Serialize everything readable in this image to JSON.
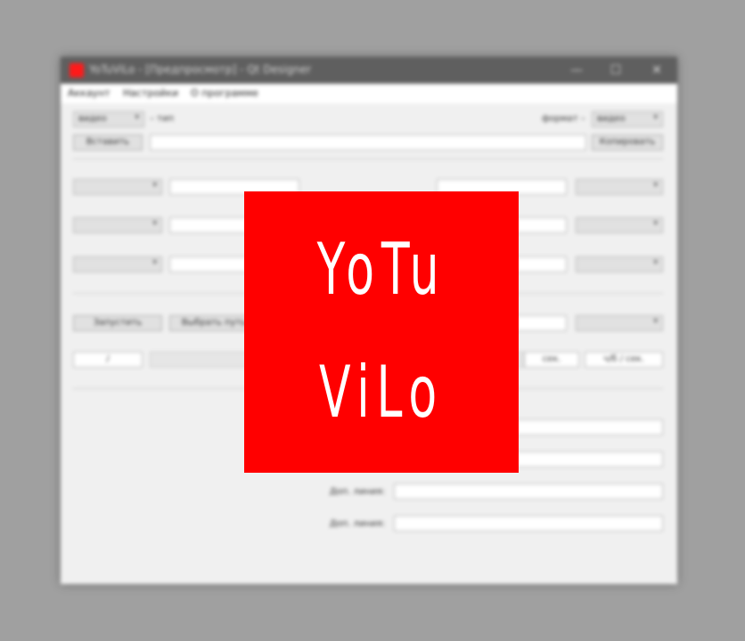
{
  "window": {
    "title": "YoTuViLo - [Предпросмотр] - Qt Designer",
    "minimize_glyph": "—",
    "maximize_glyph": "☐",
    "close_glyph": "✕",
    "app_icon": "app-logo-icon"
  },
  "menu": {
    "items": [
      "Аккаунт",
      "Настройки",
      "О программе"
    ]
  },
  "top_row": {
    "type_combo": "видео",
    "type_label": "– тип",
    "format_label": "формат –",
    "format_combo": "видео",
    "paste_button": "Вставить",
    "url_value": "",
    "copy_button": "Копировать"
  },
  "streams": {
    "left_combos": [
      "",
      "",
      ""
    ],
    "left_fields": [
      "",
      "",
      ""
    ],
    "right_fields": [
      "",
      "",
      ""
    ],
    "right_combos": [
      "",
      "",
      ""
    ]
  },
  "actions": {
    "start_button": "Запустить",
    "choose_path_button": "Выбрать путь",
    "path_value": "",
    "right_combo": ""
  },
  "status": {
    "counter": "/",
    "progress": 0,
    "time_left": "сек.",
    "time_total": "ч/б / сек."
  },
  "extra": {
    "rows": [
      {
        "label": "",
        "value": ""
      },
      {
        "label": "",
        "value": ""
      },
      {
        "label": "Доп. линия:",
        "value": ""
      },
      {
        "label": "Доп. линия:",
        "value": ""
      }
    ]
  },
  "splash": {
    "line1": "YoTu",
    "line2": "ViLo",
    "background": "#ff0000",
    "text_color": "#ffffff"
  },
  "colors": {
    "backdrop": "#a0a0a0",
    "titlebar": "#5f5f5f",
    "window_bg": "#f0f0f0",
    "accent": "#ff0000"
  }
}
